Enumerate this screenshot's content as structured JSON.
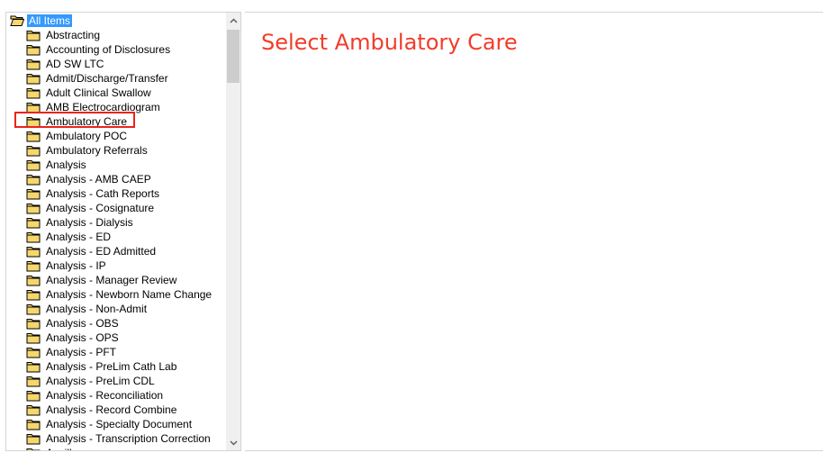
{
  "tree": {
    "root_label": "All Items",
    "items": [
      {
        "label": "Abstracting"
      },
      {
        "label": "Accounting of Disclosures"
      },
      {
        "label": "AD SW LTC"
      },
      {
        "label": "Admit/Discharge/Transfer"
      },
      {
        "label": "Adult Clinical Swallow"
      },
      {
        "label": "AMB Electrocardiogram"
      },
      {
        "label": "Ambulatory Care"
      },
      {
        "label": "Ambulatory POC"
      },
      {
        "label": "Ambulatory Referrals"
      },
      {
        "label": "Analysis"
      },
      {
        "label": "Analysis - AMB CAEP"
      },
      {
        "label": "Analysis - Cath Reports"
      },
      {
        "label": "Analysis - Cosignature"
      },
      {
        "label": "Analysis - Dialysis"
      },
      {
        "label": "Analysis - ED"
      },
      {
        "label": "Analysis - ED Admitted"
      },
      {
        "label": "Analysis - IP"
      },
      {
        "label": "Analysis - Manager Review"
      },
      {
        "label": "Analysis - Newborn Name Change"
      },
      {
        "label": "Analysis - Non-Admit"
      },
      {
        "label": "Analysis - OBS"
      },
      {
        "label": "Analysis - OPS"
      },
      {
        "label": "Analysis - PFT"
      },
      {
        "label": "Analysis - PreLim Cath Lab"
      },
      {
        "label": "Analysis - PreLim CDL"
      },
      {
        "label": "Analysis - Reconciliation"
      },
      {
        "label": "Analysis - Record Combine"
      },
      {
        "label": "Analysis - Specialty Document"
      },
      {
        "label": "Analysis - Transcription Correction"
      },
      {
        "label": "Ancillary"
      }
    ]
  },
  "instruction": {
    "text": "Select Ambulatory Care"
  },
  "colors": {
    "instruction": "#f23c2a",
    "highlight_box": "#e8251d",
    "selection": "#3399ff",
    "folder": "#f5d76e"
  },
  "icons": {
    "folder": "folder-icon",
    "open_folder": "open-folder-icon",
    "scroll_up": "chevron-up-icon",
    "scroll_down": "chevron-down-icon"
  }
}
